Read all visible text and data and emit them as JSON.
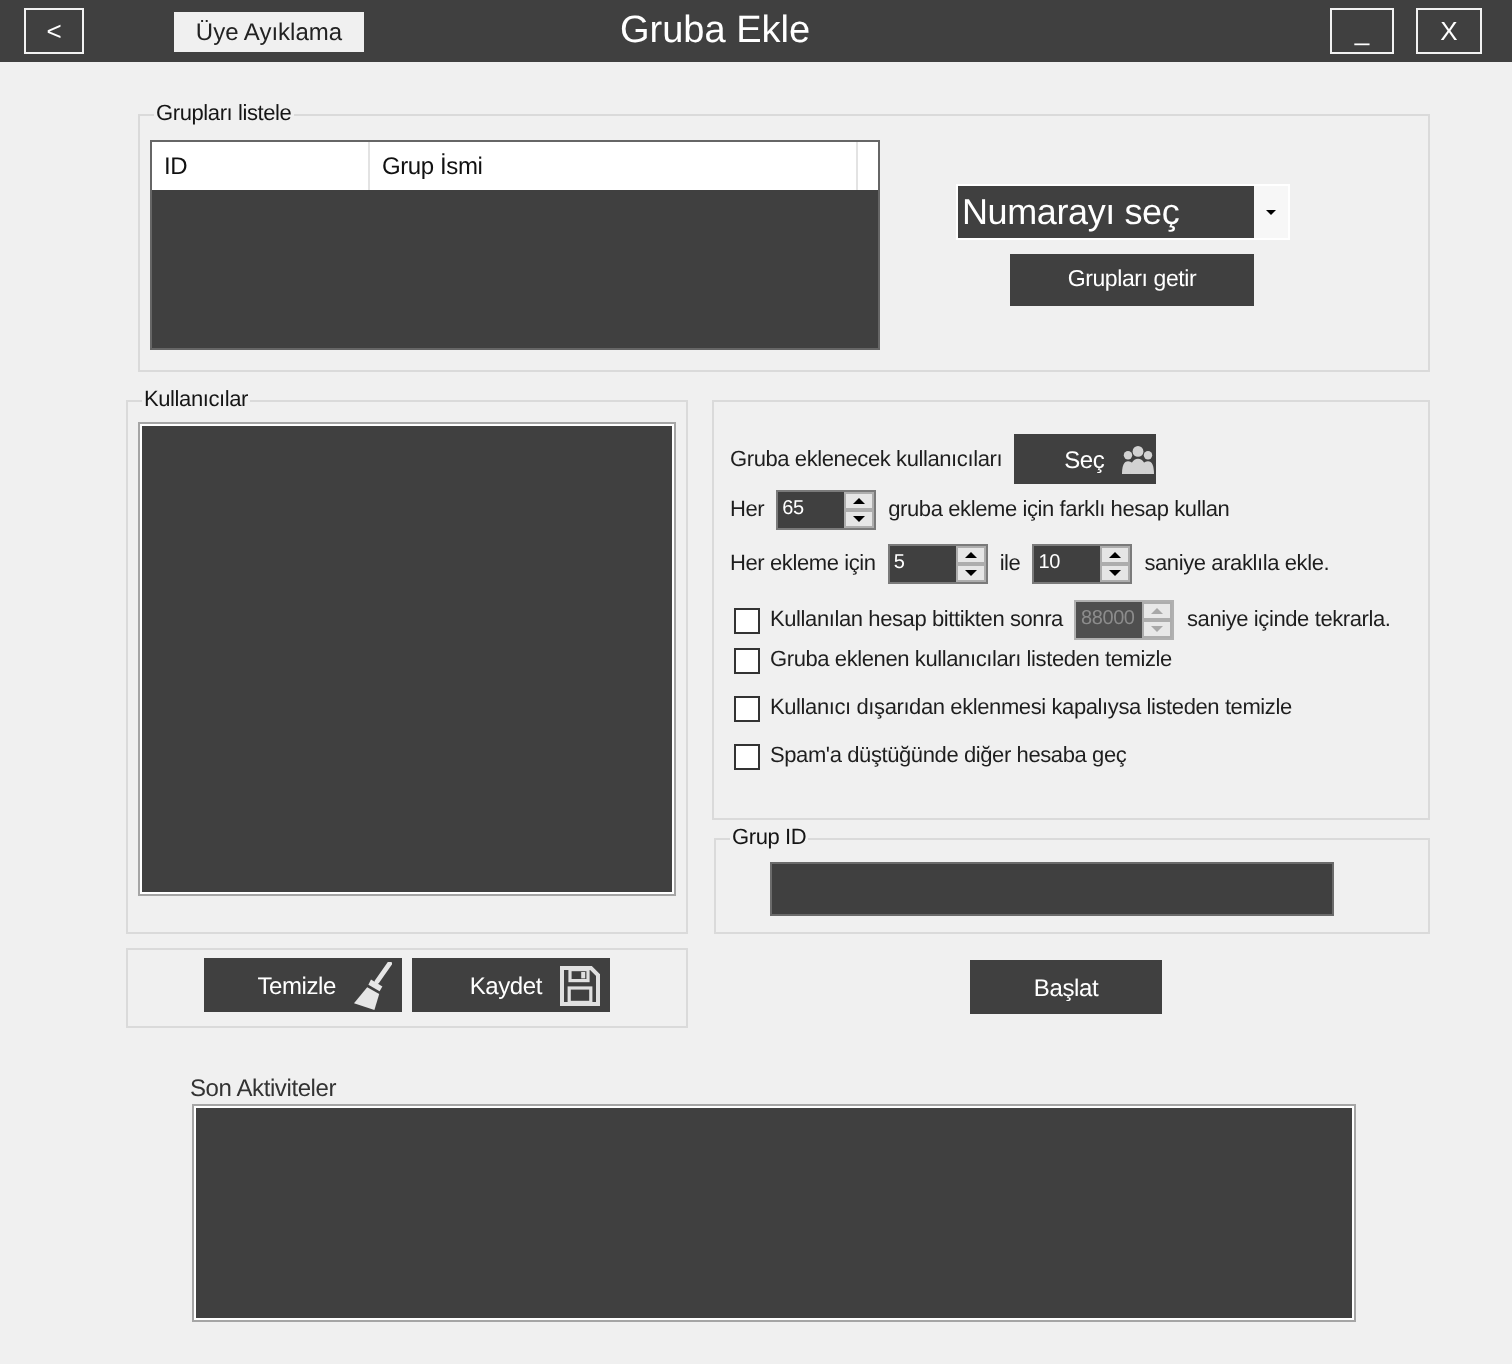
{
  "title_bar": {
    "back_button": "<",
    "nav_button": "Üye Ayıklama",
    "title": "Gruba Ekle",
    "minimize_button": "_",
    "close_button": "X"
  },
  "groups_box": {
    "title": "Grupları listele",
    "table": {
      "columns": [
        "ID",
        "Grup İsmi"
      ]
    },
    "number_dropdown": {
      "text": "Numarayı seç"
    },
    "fetch_button": "Grupları getir"
  },
  "users_box": {
    "title": "Kullanıcılar",
    "buttons": [
      "Temizle",
      "Kaydet"
    ]
  },
  "options_box": {
    "rows": [
      {
        "kind": "line",
        "parts": [
          {
            "kind": "text",
            "text": "Gruba eklenecek kullanıcıları"
          },
          {
            "kind": "button",
            "label": "Seç"
          }
        ]
      },
      {
        "kind": "line",
        "parts": [
          {
            "kind": "text",
            "text": "Her"
          },
          {
            "kind": "spinner",
            "value": "65",
            "disabled": false
          },
          {
            "kind": "text",
            "text": "gruba ekleme için farklı hesap kullan"
          }
        ]
      },
      {
        "kind": "line",
        "parts": [
          {
            "kind": "text",
            "text": "Her ekleme için"
          },
          {
            "kind": "spinner",
            "value": "5",
            "disabled": false
          },
          {
            "kind": "text",
            "text": "ile"
          },
          {
            "kind": "spinner",
            "value": "10",
            "disabled": false
          },
          {
            "kind": "text",
            "text": "saniye araklıla ekle."
          }
        ]
      },
      {
        "kind": "check",
        "checked": false,
        "parts": [
          {
            "kind": "text",
            "text": "Kullanılan hesap bittikten sonra"
          },
          {
            "kind": "spinner",
            "value": "88000",
            "disabled": true
          },
          {
            "kind": "text",
            "text": "saniye içinde tekrarla."
          }
        ]
      },
      {
        "kind": "check",
        "checked": false,
        "parts": [
          {
            "kind": "text",
            "text": "Gruba eklenen kullanıcıları listeden temizle"
          }
        ]
      },
      {
        "kind": "check",
        "checked": false,
        "parts": [
          {
            "kind": "text",
            "text": "Kullanıcı dışarıdan eklenmesi kapalıysa listeden temizle"
          }
        ]
      },
      {
        "kind": "check",
        "checked": false,
        "parts": [
          {
            "kind": "text",
            "text": "Spam'a düştüğünde diğer hesaba geç"
          }
        ]
      }
    ]
  },
  "group_id_box": {
    "title": "Grup ID"
  },
  "start_button": "Başlat",
  "activity": {
    "label": "Son Aktiviteler"
  }
}
